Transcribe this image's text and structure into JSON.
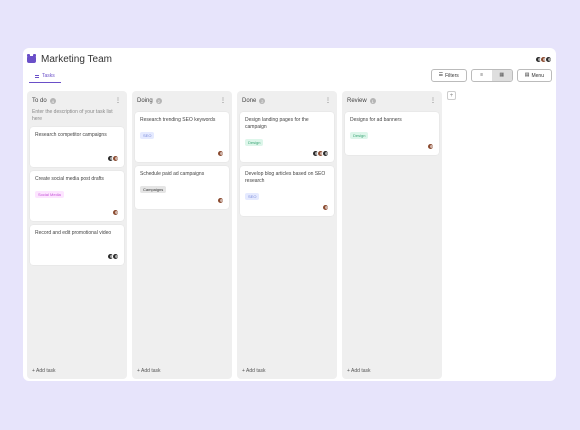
{
  "header": {
    "title": "Marketing Team",
    "icon": "gamepad-icon",
    "accent_color": "#6a4fc8"
  },
  "tabs": [
    {
      "label": "Tasks",
      "icon": "list-icon",
      "active": true
    }
  ],
  "toolbar": {
    "filters_label": "Filters",
    "menu_label": "Menu",
    "views": [
      {
        "name": "list-view",
        "icon": "list-icon",
        "active": false
      },
      {
        "name": "board-view",
        "icon": "board-icon",
        "active": true
      }
    ]
  },
  "columns": [
    {
      "name": "To do",
      "count": "4",
      "description": "Enter the description of your task list here",
      "add_label": "+ Add task",
      "cards": [
        {
          "title": "Research competitor campaigns",
          "tag": null,
          "avatars": [
            "dark",
            "brown"
          ]
        },
        {
          "title": "Create social media post drafts",
          "tag": {
            "label": "Social Media",
            "kind": "social"
          },
          "avatars": [
            "brown"
          ]
        },
        {
          "title": "Record and edit promotional video",
          "tag": null,
          "avatars": [
            "dark",
            "dark"
          ]
        }
      ]
    },
    {
      "name": "Doing",
      "count": "2",
      "description": "",
      "add_label": "+ Add task",
      "cards": [
        {
          "title": "Research trending SEO keywords",
          "tag": {
            "label": "SEO",
            "kind": "seo"
          },
          "avatars": [
            "brown"
          ]
        },
        {
          "title": "Schedule paid ad campaigns",
          "tag": {
            "label": "Campaigns",
            "kind": "campaigns"
          },
          "avatars": [
            "brown"
          ]
        }
      ]
    },
    {
      "name": "Done",
      "count": "2",
      "description": "",
      "add_label": "+ Add task",
      "cards": [
        {
          "title": "Design landing pages for the campaign",
          "tag": {
            "label": "Design",
            "kind": "design"
          },
          "avatars": [
            "dark",
            "brown",
            "dark"
          ]
        },
        {
          "title": "Develop blog articles based on SEO research",
          "tag": {
            "label": "SEO",
            "kind": "seo"
          },
          "avatars": [
            "brown"
          ]
        }
      ]
    },
    {
      "name": "Review",
      "count": "1",
      "description": "",
      "add_label": "+ Add task",
      "cards": [
        {
          "title": "Designs for ad banners",
          "tag": {
            "label": "Design",
            "kind": "design"
          },
          "avatars": [
            "brown"
          ]
        }
      ]
    }
  ],
  "add_column_label": "+",
  "top_avatars": [
    "dark",
    "brown",
    "dark"
  ]
}
